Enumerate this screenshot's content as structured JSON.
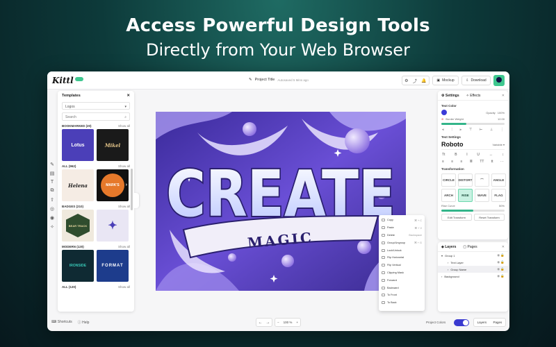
{
  "hero": {
    "line1": "Access Powerful Design Tools",
    "line2": "Directly from Your Web Browser"
  },
  "topbar": {
    "logo": "Kittl",
    "project_title": "Project Title",
    "autosaved": "Autosaved 5 Mins ago",
    "mockup_label": "Mockup",
    "download_label": "Download"
  },
  "templates": {
    "title": "Templates",
    "category": "Logos",
    "search_placeholder": "Search",
    "sections": [
      {
        "label": "BOOKMARKED (20)",
        "show_all": "Show all",
        "items": [
          "Lotus",
          "Mikel"
        ]
      },
      {
        "label": "ALL (962)",
        "show_all": "Show all",
        "items": [
          "Helena",
          "MARK'S"
        ]
      },
      {
        "label": "BADGES (210)",
        "show_all": "Show all",
        "items": [
          "BEAR TRACK",
          ""
        ]
      },
      {
        "label": "MODERN (120)",
        "show_all": "Show all",
        "items": [
          "IRONSIDE",
          "FORMAT"
        ]
      },
      {
        "label": "ALL (120)",
        "show_all": "Show all",
        "items": []
      }
    ]
  },
  "canvas": {
    "word1": "CREATE",
    "word2": "MAGIC"
  },
  "context_menu": {
    "items": [
      {
        "label": "Copy",
        "shortcut": "⌘ + C"
      },
      {
        "label": "Paste",
        "shortcut": "⌘ + V"
      },
      {
        "label": "Delete",
        "shortcut": "Backspace"
      },
      {
        "label": "Group/Ungroup",
        "shortcut": "⌘ + G"
      },
      {
        "label": "Lock/Unlock",
        "shortcut": ""
      },
      {
        "label": "Flip Horizontal",
        "shortcut": ""
      },
      {
        "label": "Flip Vertical",
        "shortcut": ""
      },
      {
        "label": "Clipping Mask",
        "shortcut": ""
      },
      {
        "label": "Forward",
        "shortcut": ""
      },
      {
        "label": "Backward",
        "shortcut": ""
      },
      {
        "label": "To Front",
        "shortcut": ""
      },
      {
        "label": "To Back",
        "shortcut": ""
      }
    ]
  },
  "settings": {
    "tab_settings": "Settings",
    "tab_effects": "Effects",
    "text_color": "Text Color",
    "opacity_label": "Opacity",
    "opacity_value": "100%",
    "opacity_level": 1.0,
    "border_weight_label": "Border Weight",
    "border_weight_value": "12.00",
    "border_weight_level": 0.4,
    "text_settings": "Text Settings",
    "font_name": "Roboto",
    "font_variant": "Variable",
    "transformation": "Transformation",
    "transform_options": [
      "CLASSIC",
      "ARCH",
      "RISE",
      "WAVE",
      "FLAG",
      "ANGLE",
      "DISTORT",
      "CIRCLE"
    ],
    "active_transform": "RISE",
    "rise_curve_label": "Rise Curve",
    "rise_curve_value": "50%",
    "rise_curve_level": 0.5,
    "edit_transform": "Edit Transform",
    "reset_transform": "Reset Transform",
    "text_color_hex": "#3b3bd8"
  },
  "layers": {
    "tab_layers": "Layers",
    "tab_pages": "Pages",
    "items": [
      {
        "label": "Group 1",
        "indent": 0
      },
      {
        "label": "Text Layer",
        "indent": 1
      },
      {
        "label": "Group Name",
        "indent": 1
      },
      {
        "label": "Background",
        "indent": 0
      }
    ]
  },
  "footer": {
    "shortcuts": "Shortcuts",
    "help": "Help",
    "zoom": "100 %",
    "project_colors": "Project Colors",
    "layers": "Layers",
    "pages": "Pages"
  },
  "colors": {
    "accent": "#3ec78f",
    "canvas_purple": "#5b3ec9"
  }
}
